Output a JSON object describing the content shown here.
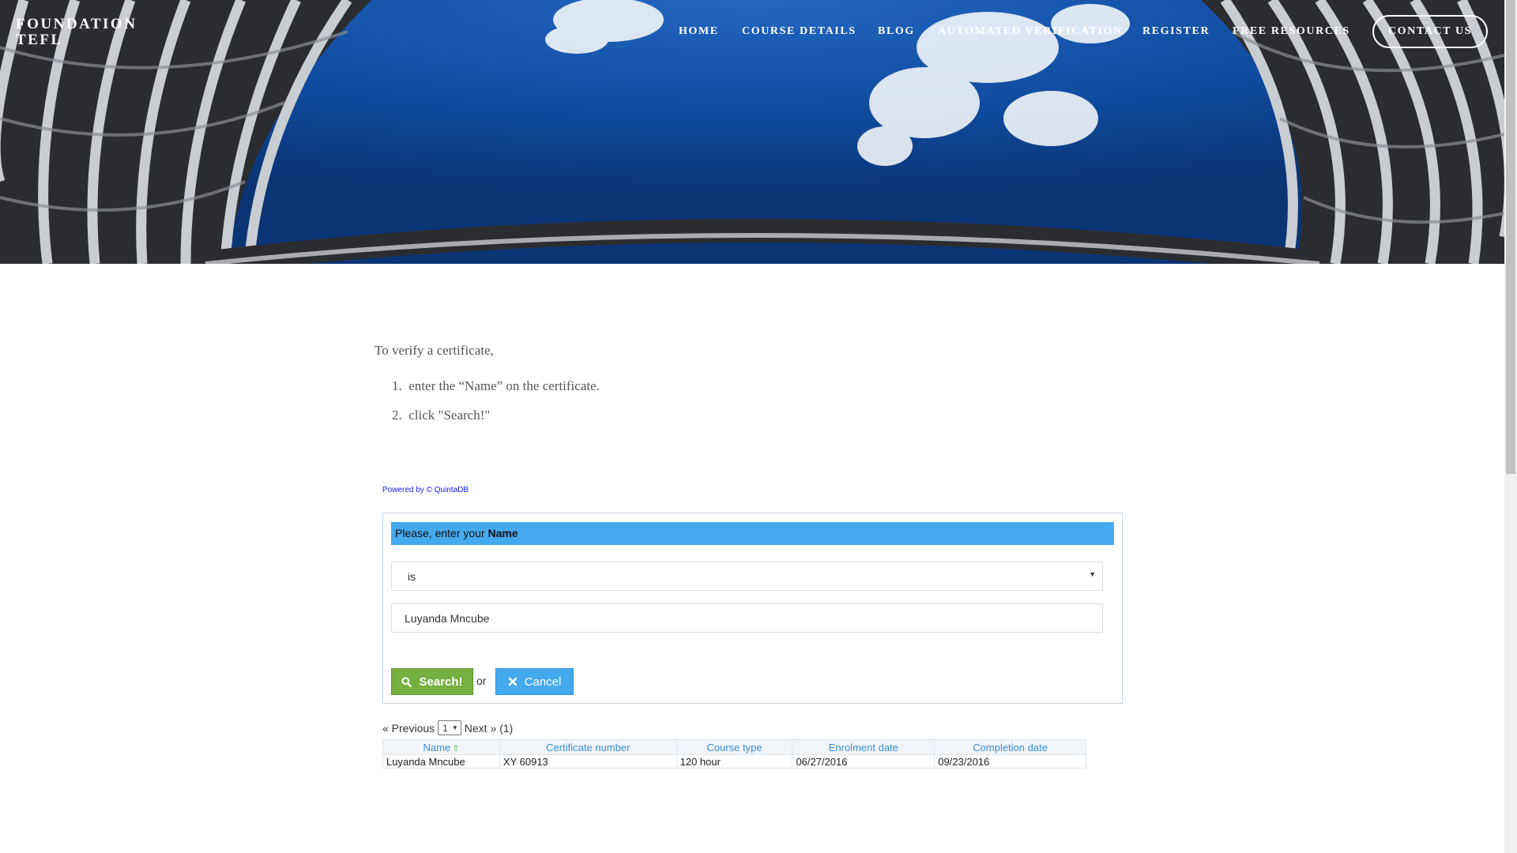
{
  "brand": {
    "line1": "FOUNDATION",
    "line2": "TEFL"
  },
  "nav": {
    "items": [
      "HOME",
      "COURSE DETAILS",
      "BLOG",
      "AUTOMATED VERIFICATION",
      "REGISTER",
      "FREE RESOURCES"
    ],
    "contact": "CONTACT US"
  },
  "intro": "To verify a certificate,",
  "steps": [
    {
      "num": "1.",
      "text": "enter the “Name” on the certificate."
    },
    {
      "num": "2.",
      "text": "click \"Search!\""
    }
  ],
  "powered_by": "Powered by © QuintaDB",
  "form": {
    "prompt_prefix": "Please, enter your ",
    "prompt_field": "Name",
    "operator": "is",
    "name_value": "Luyanda Mncube",
    "search_label": "Search!",
    "or_label": "or",
    "cancel_label": "Cancel"
  },
  "pager": {
    "prev": "« Previous",
    "page": "1",
    "next": "Next »",
    "count": "(1)"
  },
  "table": {
    "headers": [
      "Name",
      "Certificate number",
      "Course type",
      "Enrolment date",
      "Completion date"
    ],
    "rows": [
      [
        "Luyanda Mncube",
        "XY 60913",
        "120 hour",
        "06/27/2016",
        "09/23/2016"
      ]
    ]
  },
  "colors": {
    "accent_blue": "#45a9ee",
    "search_green": "#76b041",
    "header_link": "#3b8fd6"
  }
}
